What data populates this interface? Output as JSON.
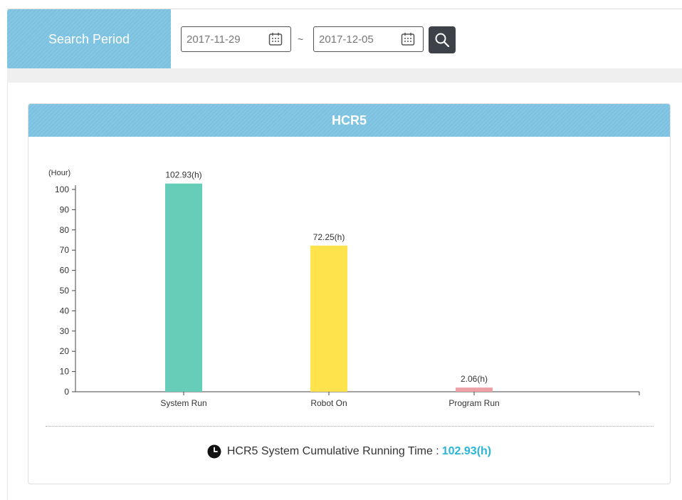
{
  "search": {
    "label": "Search Period",
    "start_date": "2017-11-29",
    "separator": "~",
    "end_date": "2017-12-05"
  },
  "panel": {
    "title": "HCR5"
  },
  "footer": {
    "label": "HCR5 System Cumulative Running Time :",
    "total": "102.93(h)"
  },
  "chart_data": {
    "type": "bar",
    "title": "",
    "ylabel": "(Hour)",
    "xlabel": "",
    "categories": [
      "System Run",
      "Robot On",
      "Program Run"
    ],
    "values": [
      102.93,
      72.25,
      2.06
    ],
    "data_labels": [
      "102.93(h)",
      "72.25(h)",
      "2.06(h)"
    ],
    "colors": [
      "#66cdb9",
      "#ffe34d",
      "#eda0a6"
    ],
    "ylim": [
      0,
      100
    ],
    "yticks": [
      0,
      10,
      20,
      30,
      40,
      50,
      60,
      70,
      80,
      90,
      100
    ],
    "grid": false,
    "legend": "none"
  }
}
